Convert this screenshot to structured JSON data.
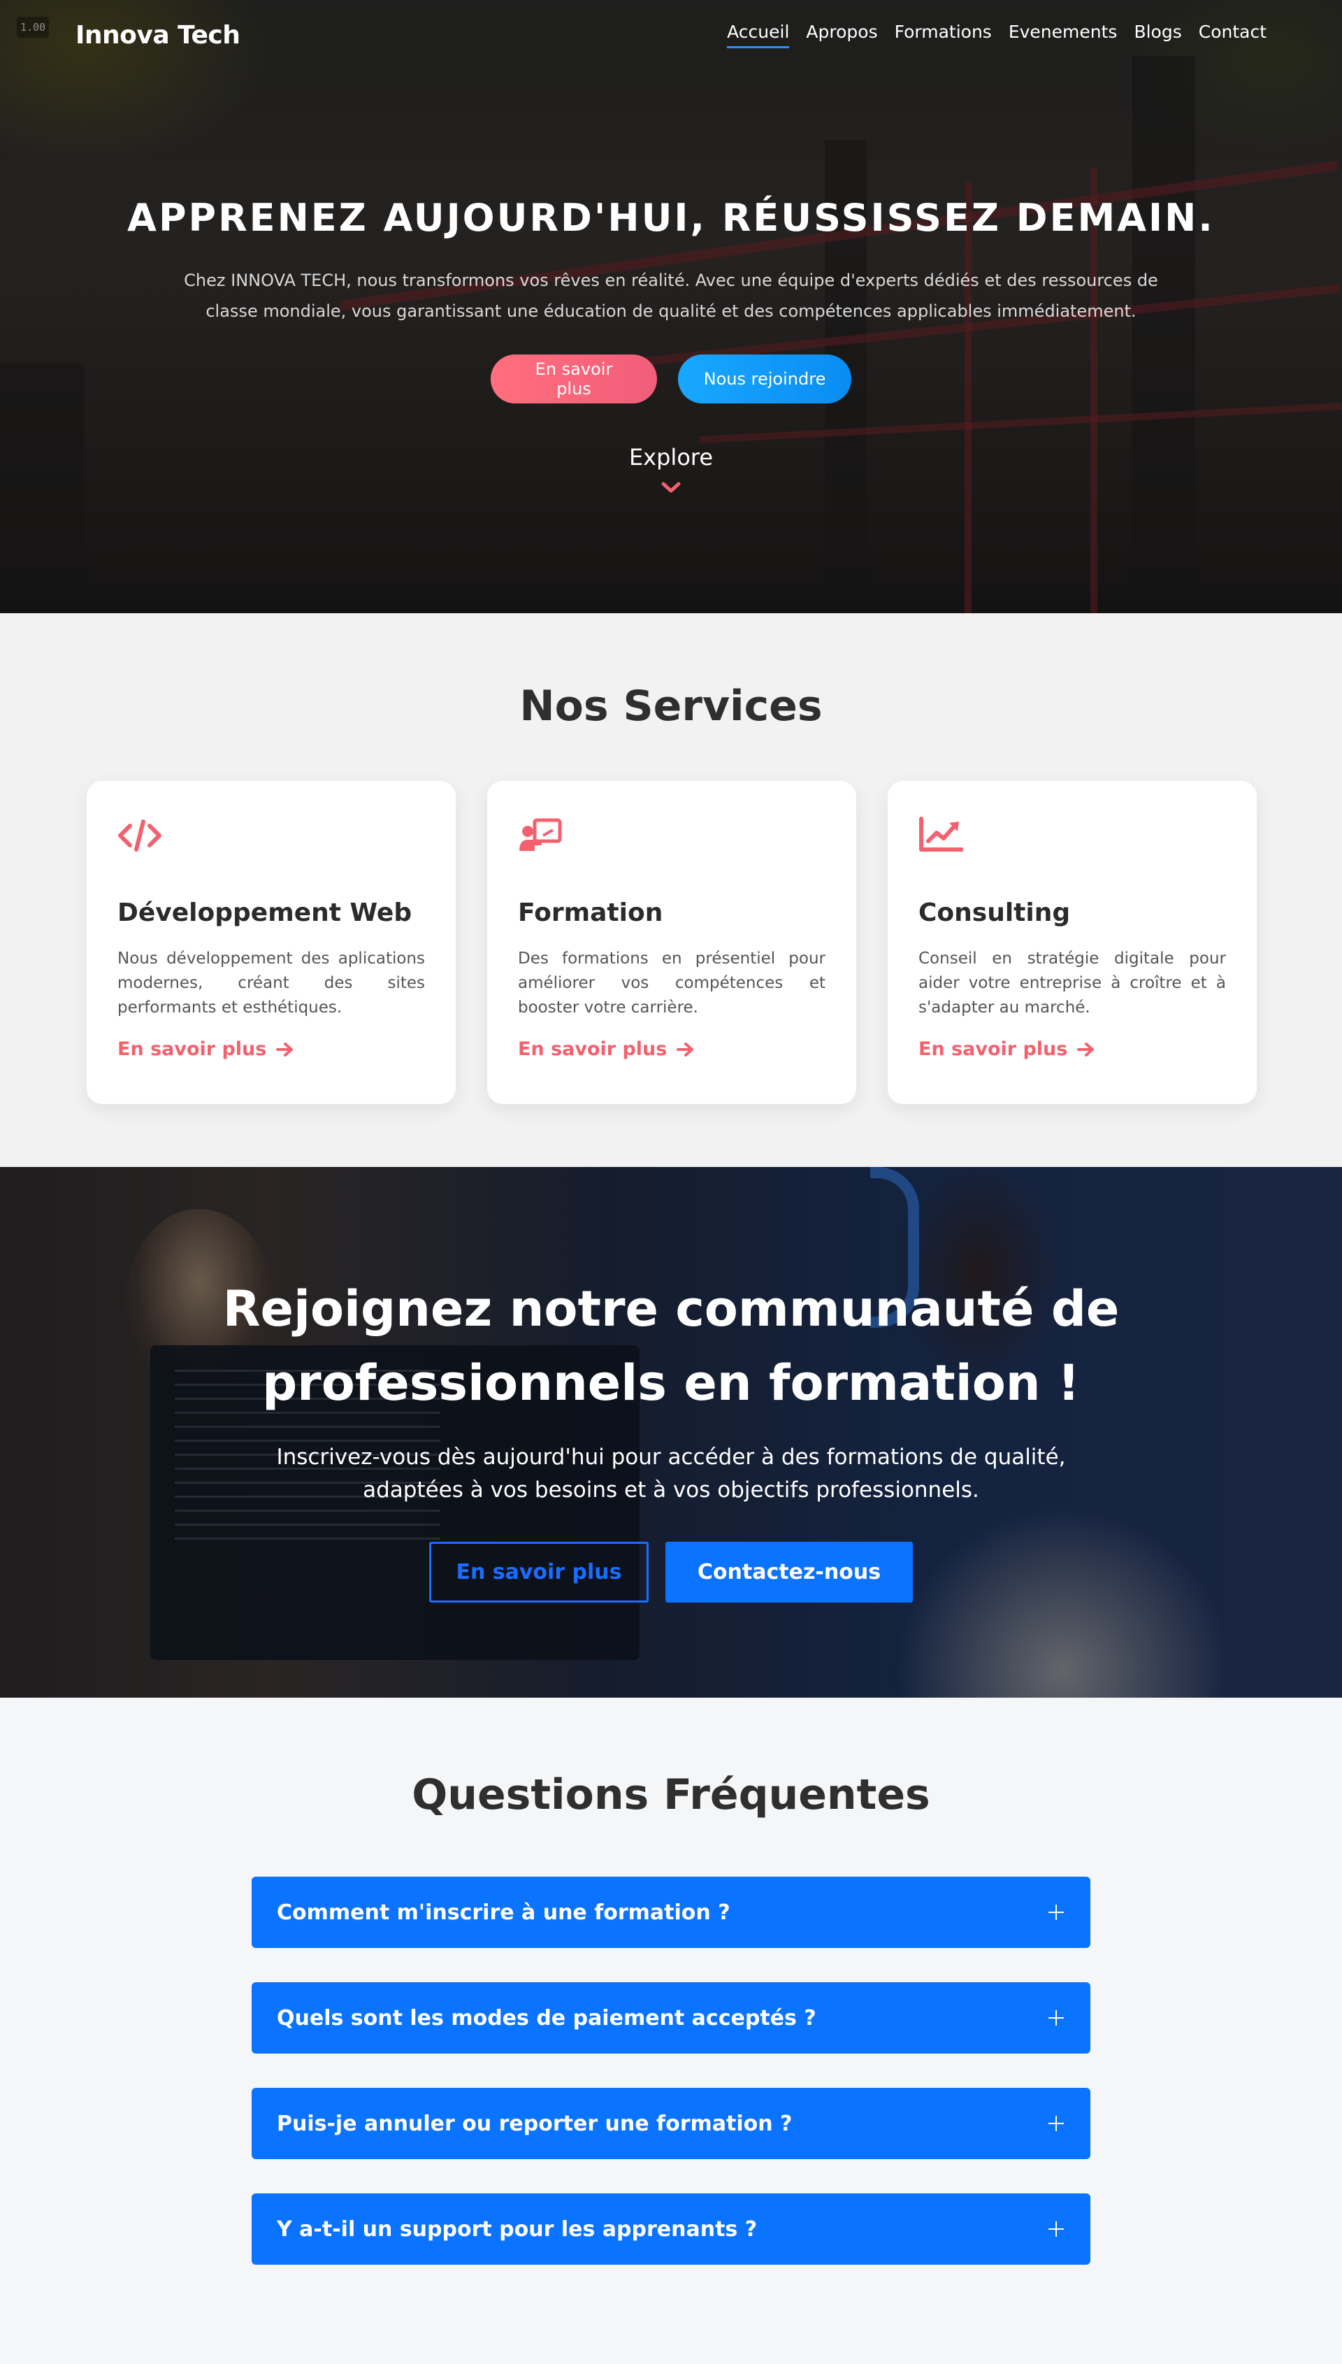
{
  "version_tag": "1.00",
  "header": {
    "brand": "Innova Tech",
    "nav": [
      {
        "label": "Accueil",
        "active": true
      },
      {
        "label": "Apropos"
      },
      {
        "label": "Formations"
      },
      {
        "label": "Evenements"
      },
      {
        "label": "Blogs"
      },
      {
        "label": "Contact"
      }
    ]
  },
  "hero": {
    "title": "APPRENEZ AUJOURD'HUI, RÉUSSISSEZ DEMAIN.",
    "subtitle": "Chez INNOVA TECH, nous transformons vos rêves en réalité. Avec une équipe d'experts dédiés et des ressources de classe mondiale, vous garantissant une éducation de qualité et des compétences applicables immédiatement.",
    "btn_primary": "En savoir plus",
    "btn_secondary": "Nous rejoindre",
    "explore": "Explore"
  },
  "services": {
    "title": "Nos Services",
    "cards": [
      {
        "icon": "code-icon",
        "title": "Développement Web",
        "text": "Nous développement des aplications modernes, créant des sites performants et esthétiques.",
        "link": "En savoir plus"
      },
      {
        "icon": "chalkboard-teacher-icon",
        "title": "Formation",
        "text": "Des formations en présentiel pour améliorer vos compétences et booster votre carrière.",
        "link": "En savoir plus"
      },
      {
        "icon": "chart-line-icon",
        "title": "Consulting",
        "text": "Conseil en stratégie digitale pour aider votre entreprise à croître et à s'adapter au marché.",
        "link": "En savoir plus"
      }
    ]
  },
  "community": {
    "title_line1": "Rejoignez notre communauté de",
    "title_line2": "professionnels en formation !",
    "sub_line1": "Inscrivez-vous dès aujourd'hui pour accéder à des formations de qualité,",
    "sub_line2": "adaptées à vos besoins et à vos objectifs professionnels.",
    "btn_outline": "En savoir plus",
    "btn_solid": "Contactez-nous"
  },
  "faq": {
    "title": "Questions Fréquentes",
    "items": [
      {
        "question": "Comment m'inscrire à une formation ?"
      },
      {
        "question": "Quels sont les modes de paiement acceptés ?"
      },
      {
        "question": "Puis-je annuler ou reporter une formation ?"
      },
      {
        "question": "Y a-t-il un support pour les apprenants ?"
      }
    ]
  },
  "colors": {
    "accent_pink": "#f4616e",
    "accent_blue": "#0a73ff",
    "nav_active_underline": "#2a8cff"
  }
}
